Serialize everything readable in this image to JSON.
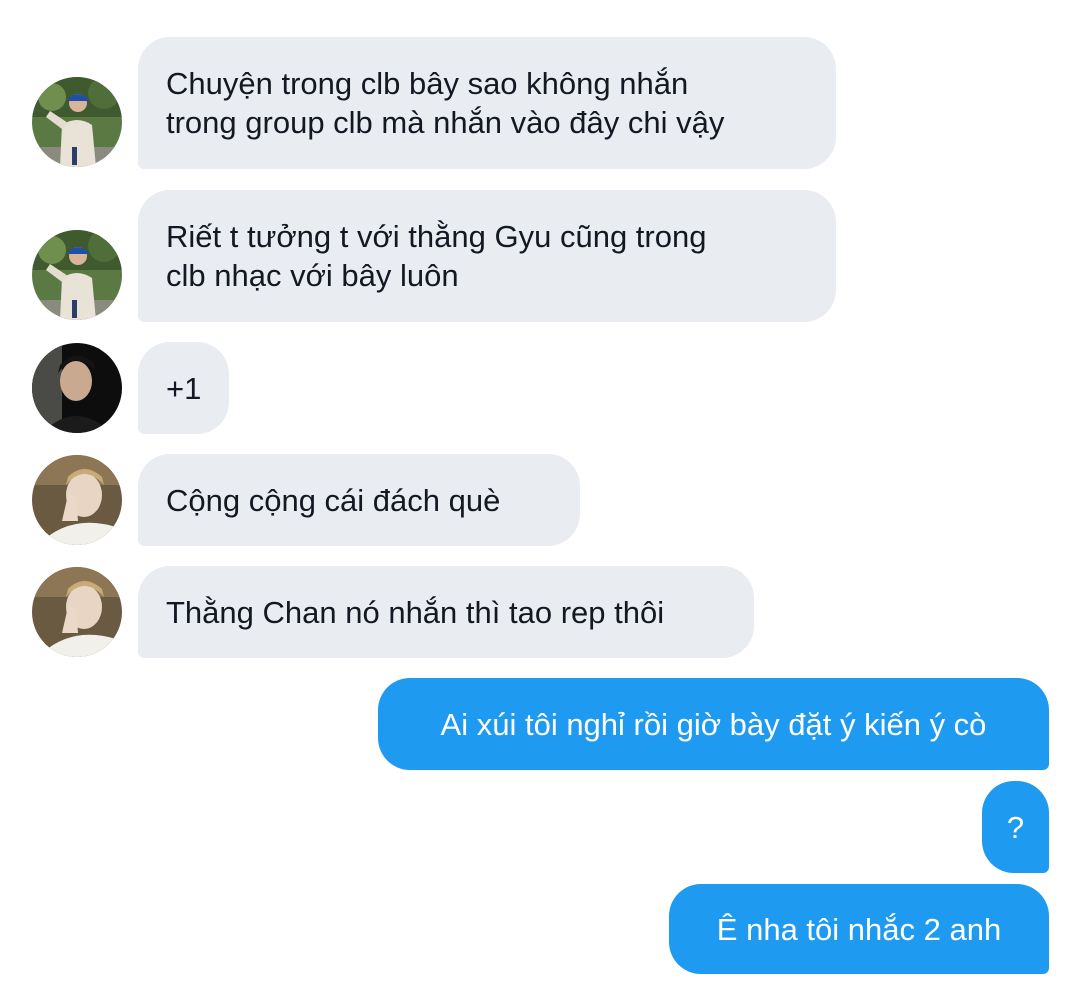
{
  "conversation": {
    "messages": [
      {
        "id": "m1",
        "direction": "incoming",
        "sender_avatar": "avatar-1",
        "text": "Chuyện trong clb bây sao không nhắn\ntrong group clb mà nhắn vào đây chi vậy"
      },
      {
        "id": "m2",
        "direction": "incoming",
        "sender_avatar": "avatar-1",
        "text": "Riết t tưởng t với thằng Gyu cũng trong\nclb nhạc với bây luôn"
      },
      {
        "id": "m3",
        "direction": "incoming",
        "sender_avatar": "avatar-2",
        "text": "+1"
      },
      {
        "id": "m4",
        "direction": "incoming",
        "sender_avatar": "avatar-3",
        "text": "Cộng cộng cái đách què"
      },
      {
        "id": "m5",
        "direction": "incoming",
        "sender_avatar": "avatar-3",
        "text": "Thằng Chan nó nhắn thì tao rep thôi"
      },
      {
        "id": "m6",
        "direction": "outgoing",
        "text": "Ai xúi tôi nghỉ rồi giờ bày đặt ý kiến ý cò"
      },
      {
        "id": "m7",
        "direction": "outgoing",
        "text": "?"
      },
      {
        "id": "m8",
        "direction": "outgoing",
        "text": "Ê nha tôi nhắc 2 anh"
      }
    ]
  },
  "colors": {
    "incoming_bubble": "#e9ecf1",
    "outgoing_bubble": "#1e9bf0",
    "incoming_text": "#141823",
    "outgoing_text": "#ffffff",
    "background": "#ffffff"
  }
}
